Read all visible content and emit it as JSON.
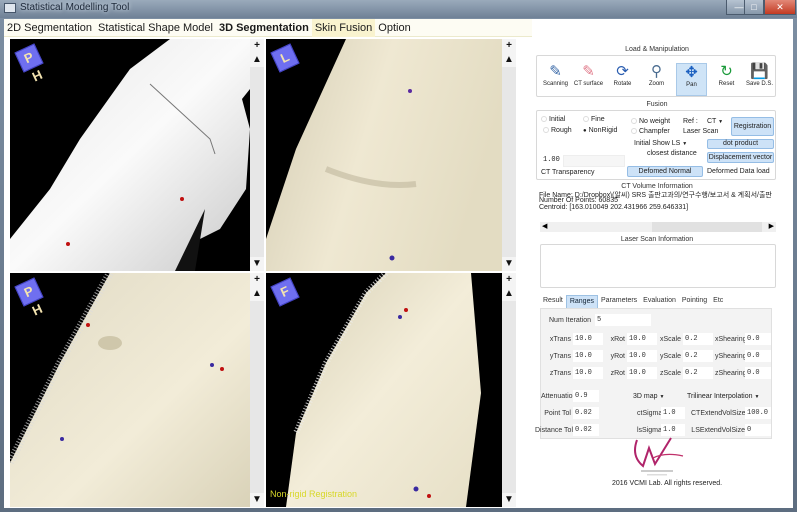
{
  "window": {
    "title": "Statistical Modelling Tool",
    "controls": [
      "minimize",
      "maximize",
      "close"
    ]
  },
  "menu": [
    {
      "label": "2D Segmentation",
      "bold": false,
      "active": false
    },
    {
      "label": "Statistical Shape Model",
      "bold": false,
      "active": false
    },
    {
      "label": "3D Segmentation",
      "bold": true,
      "active": false
    },
    {
      "label": "Skin Fusion",
      "bold": false,
      "active": true
    },
    {
      "label": "Option",
      "bold": false,
      "active": false
    }
  ],
  "viewports": [
    {
      "id": "top-left",
      "orientation": "P H",
      "mode": "grayscale"
    },
    {
      "id": "top-right",
      "orientation": "L",
      "mode": "skin"
    },
    {
      "id": "bottom-left",
      "orientation": "P H",
      "mode": "skin-points"
    },
    {
      "id": "bottom-right",
      "orientation": "F",
      "mode": "skin-points",
      "overlay_text": "Non-rigid Registration"
    }
  ],
  "viewport_controls": {
    "plus": "+",
    "up": "▲",
    "down": "▼"
  },
  "load_manipulation": {
    "title": "Load & Manipulation",
    "tools": [
      {
        "label": "Scanning",
        "icon": "scan-icon",
        "active": false
      },
      {
        "label": "CT surface",
        "icon": "ct-surface-icon",
        "active": false
      },
      {
        "label": "Rotate",
        "icon": "rotate-icon",
        "active": false
      },
      {
        "label": "Zoom",
        "icon": "zoom-icon",
        "active": false
      },
      {
        "label": "Pan",
        "icon": "pan-icon",
        "active": true
      },
      {
        "label": "Reset",
        "icon": "reset-icon",
        "active": false
      },
      {
        "label": "Save D.S.",
        "icon": "save-icon",
        "active": false
      }
    ]
  },
  "fusion": {
    "title": "Fusion",
    "radio_initial": "Initial",
    "radio_rough": "Rough",
    "radio_fine": "Fine",
    "radio_nonrigid": "NonRigid",
    "radio_noweight": "No weight",
    "radio_champfer": "Champfer",
    "ref_label": "Ref :",
    "ref_value": "CT",
    "laser_scan": "Laser Scan",
    "registration": "Registration",
    "initial_show_label": "Initial Show LS",
    "closest_distance": "closest distance",
    "dot_product": "dot product",
    "displacement_vector": "Displacement vector",
    "transparency_value": "1.00",
    "ct_transparency": "CT Transparency",
    "deformed_normal": "Defomed Normal",
    "deformed_data_load": "Deformed Data load"
  },
  "ct_info": {
    "title": "CT Volume Information",
    "lines": [
      "File Name: D:/Dropbox\\(알씨) SRS 출판고과의/연구수행/보고서 & 계획서/출판",
      "Number Of Points: 60835",
      "Centroid: [163.010049 202.431966 259.646331]"
    ]
  },
  "laser_info": {
    "title": "Laser Scan Information"
  },
  "tabs": [
    "Result",
    "Ranges",
    "Parameters",
    "Evaluation",
    "Pointing",
    "Etc"
  ],
  "active_tab": "Ranges",
  "ranges": {
    "num_iteration": {
      "label": "Num Iteration",
      "value": "5"
    },
    "rows": [
      [
        {
          "label": "xTrans",
          "value": "10.0"
        },
        {
          "label": "xRot",
          "value": "10.0"
        },
        {
          "label": "xScale",
          "value": "0.2"
        },
        {
          "label": "xShearing",
          "value": "0.0"
        }
      ],
      [
        {
          "label": "yTrans",
          "value": "10.0"
        },
        {
          "label": "yRot",
          "value": "10.0"
        },
        {
          "label": "yScale",
          "value": "0.2"
        },
        {
          "label": "yShearing",
          "value": "0.0"
        }
      ],
      [
        {
          "label": "zTrans",
          "value": "10.0"
        },
        {
          "label": "zRot",
          "value": "10.0"
        },
        {
          "label": "zScale",
          "value": "0.2"
        },
        {
          "label": "zShearing",
          "value": "0.0"
        }
      ]
    ],
    "attenuation": {
      "label": "Attenuation",
      "value": "0.9"
    },
    "point_tol": {
      "label": "Point Tol",
      "value": "0.02"
    },
    "distance_tol": {
      "label": "Distance Tol",
      "value": "0.02"
    },
    "map_select": "3D map",
    "interp_select": "Trilinear Interpolation",
    "ct_sigma": {
      "label": "ctSigma",
      "value": "1.0"
    },
    "ls_sigma": {
      "label": "lsSigma",
      "value": "1.0"
    },
    "ct_extend": {
      "label": "CTExtendVolSize",
      "value": "100.0"
    },
    "ls_extend": {
      "label": "LSExtendVolSize",
      "value": "0"
    }
  },
  "footer": {
    "copyright": "2016 VCMI Lab. All rights reserved.",
    "logo_text": "VCMI"
  }
}
